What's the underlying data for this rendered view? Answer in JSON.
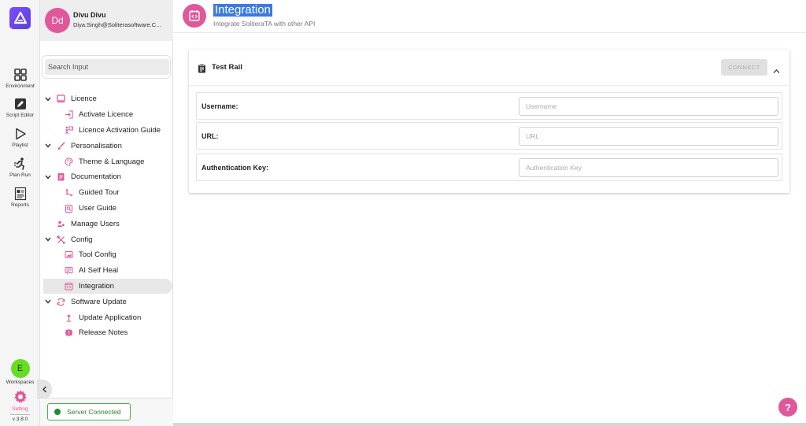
{
  "rail": {
    "items": [
      {
        "label": "Environment",
        "icon": "grid-icon"
      },
      {
        "label": "Script Editor",
        "icon": "pencil-icon"
      },
      {
        "label": "Playlist",
        "icon": "play-icon"
      },
      {
        "label": "Plan Run",
        "icon": "runner-icon"
      },
      {
        "label": "Reports",
        "icon": "report-icon"
      }
    ],
    "workspace_initial": "E",
    "workspaces_label": "Workspaces",
    "setting_label": "Setting",
    "version": "v 3.8.0"
  },
  "profile": {
    "initials": "Dd",
    "name": "Divu Divu",
    "email": "Diya.Singh@Soliterasoftware.C..."
  },
  "search": {
    "placeholder": "Search Input"
  },
  "nav": [
    {
      "label": "Licence",
      "level": 0,
      "expanded": true,
      "icon": "laptop-icon"
    },
    {
      "label": "Activate Licence",
      "level": 1,
      "icon": "login-icon"
    },
    {
      "label": "Licence Activation Guide",
      "level": 1,
      "icon": "guide-icon"
    },
    {
      "label": "Personalisation",
      "level": 0,
      "expanded": true,
      "icon": "brush-icon"
    },
    {
      "label": "Theme & Language",
      "level": 1,
      "icon": "palette-icon"
    },
    {
      "label": "Documentation",
      "level": 0,
      "expanded": true,
      "icon": "document-icon"
    },
    {
      "label": "Guided Tour",
      "level": 1,
      "icon": "tour-icon"
    },
    {
      "label": "User Guide",
      "level": 1,
      "icon": "user-guide-icon"
    },
    {
      "label": "Manage Users",
      "level": 0,
      "icon": "users-icon"
    },
    {
      "label": "Config",
      "level": 0,
      "expanded": true,
      "icon": "tools-icon"
    },
    {
      "label": "Tool Config",
      "level": 1,
      "icon": "tool-config-icon"
    },
    {
      "label": "AI Self Heal",
      "level": 1,
      "icon": "ai-heal-icon"
    },
    {
      "label": "Integration",
      "level": 1,
      "icon": "integration-icon",
      "active": true
    },
    {
      "label": "Software Update",
      "level": 0,
      "expanded": true,
      "icon": "sync-icon"
    },
    {
      "label": "Update Application",
      "level": 1,
      "icon": "update-icon"
    },
    {
      "label": "Release Notes",
      "level": 1,
      "icon": "release-notes-icon"
    }
  ],
  "status": {
    "label": "Server Connected",
    "color": "#1b8f2a"
  },
  "page": {
    "title": "Integration",
    "subtitle": "Integrate SoliteraTA with other API"
  },
  "card": {
    "title": "Test Rail",
    "connect_label": "CONNECT",
    "fields": [
      {
        "label": "Username:",
        "placeholder": "Username",
        "value": ""
      },
      {
        "label": "URL:",
        "placeholder": "URL",
        "value": ""
      },
      {
        "label": "Authentication Key:",
        "placeholder": "Authentication Key",
        "value": ""
      }
    ]
  },
  "help": {
    "label": "?"
  },
  "colors": {
    "accent": "#e0589a",
    "brand": "#6a45f0",
    "selection": "#3a7be0"
  }
}
